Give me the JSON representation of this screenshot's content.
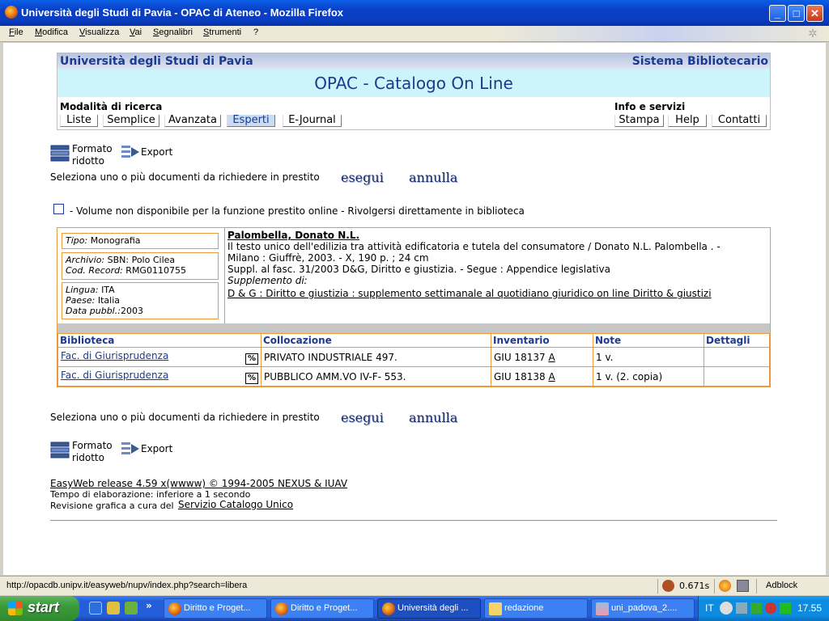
{
  "window": {
    "title": "Università degli Studi di Pavia - OPAC di Ateneo - Mozilla Firefox",
    "min": "_",
    "max": "□",
    "close": "✕"
  },
  "menu": [
    "File",
    "Modifica",
    "Visualizza",
    "Vai",
    "Segnalibri",
    "Strumenti",
    "?"
  ],
  "banner": {
    "university": "Università degli Studi di Pavia",
    "system": "Sistema Bibliotecario",
    "opac_title": "OPAC - Catalogo On Line",
    "search_modes_label": "Modalità di ricerca",
    "search_modes": [
      "Liste",
      "Semplice",
      "Avanzata",
      "Esperti",
      "E-Journal"
    ],
    "info_label": "Info e servizi",
    "info_links": [
      "Stampa",
      "Help",
      "Contatti"
    ]
  },
  "toolbar": {
    "format_label_1": "Formato",
    "format_label_2": "ridotto",
    "export_label": "Export"
  },
  "loan": {
    "prompt": "Seleziona uno o più documenti da richiedere in prestito",
    "execute": "esegui",
    "cancel": "annulla"
  },
  "notice": "- Volume non disponibile per la funzione prestito online - Rivolgersi direttamente in biblioteca",
  "record": {
    "tipo_label": "Tipo:",
    "tipo": "Monografia",
    "archivio_label": "Archivio:",
    "archivio": "SBN: Polo Cilea",
    "codrec_label": "Cod. Record:",
    "codrec": "RMG0110755",
    "lingua_label": "Lingua:",
    "lingua": "ITA",
    "paese_label": "Paese:",
    "paese": "Italia",
    "data_label": "Data pubbl.:",
    "data": "2003",
    "author": "Palombella, Donato N.L.",
    "title_line1": "Il testo unico dell'edilizia tra attività edificatoria e tutela del consumatore / Donato N.L. Palombella . -",
    "title_line2": "Milano : Giuffrè, 2003. - X, 190 p. ; 24 cm",
    "notes_line": "Suppl. al fasc. 31/2003 D&G, Diritto e giustizia. - Segue : Appendice legislativa",
    "supplement_label": "Supplemento di:",
    "supplement_link": "D & G : Diritto e giustizia : supplemento settimanale al quotidiano giuridico on line Diritto & giustizi"
  },
  "holdings": {
    "headers": [
      "Biblioteca",
      "Collocazione",
      "Inventario",
      "Note",
      "Dettagli"
    ],
    "rows": [
      {
        "library": "Fac. di Giurisprudenza",
        "pct": "%",
        "location": "PRIVATO INDUSTRIALE 497.",
        "inventory": "GIU 18137",
        "inv_link": "A",
        "note": "1 v.",
        "details": ""
      },
      {
        "library": "Fac. di Giurisprudenza",
        "pct": "%",
        "location": "PUBBLICO AMM.VO IV-F- 553.",
        "inventory": "GIU 18138",
        "inv_link": "A",
        "note": "1 v. (2. copia)",
        "details": ""
      }
    ]
  },
  "footer": {
    "release": "EasyWeb release 4.59 x(wwww) © 1994-2005 NEXUS & IUAV",
    "timing": "Tempo di elaborazione: inferiore a 1 secondo",
    "revision_prefix": "Revisione grafica a cura del",
    "revision_link": "Servizio Catalogo Unico"
  },
  "statusbar": {
    "url": "http://opacdb.unipv.it/easyweb/nupv/index.php?search=libera",
    "timer": "0.671s",
    "adblock": "Adblock"
  },
  "taskbar": {
    "start": "start",
    "chevron": "»",
    "tasks": [
      "Diritto e Proget...",
      "Diritto e Proget...",
      "Università degli ...",
      "redazione",
      "uni_padova_2...."
    ],
    "lang": "IT",
    "clock": "17.55"
  },
  "colors": {
    "accent": "#1c3a8e",
    "record_border": "#e89a3c",
    "banner_cyan": "#ccf4fb"
  }
}
